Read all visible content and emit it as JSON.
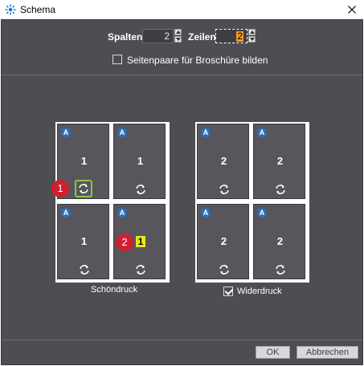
{
  "window": {
    "title": "Schema",
    "icon": "schema-grid-icon",
    "close_icon": "close-icon"
  },
  "grid": {
    "spalten_label": "Spalten",
    "spalten_value": "2",
    "zeilen_label": "Zeilen",
    "zeilen_value": "2"
  },
  "options": {
    "booklet_label": "Seitenpaare für Broschüre bilden",
    "booklet_checked": false
  },
  "front": {
    "caption": "Schöndruck",
    "pages": [
      {
        "badge": "A",
        "number": "1"
      },
      {
        "badge": "A",
        "number": "1"
      },
      {
        "badge": "A",
        "number": "1"
      },
      {
        "badge": "A",
        "number": "1"
      }
    ]
  },
  "back": {
    "caption": "Widerdruck",
    "checked": true,
    "pages": [
      {
        "badge": "A",
        "number": "2"
      },
      {
        "badge": "A",
        "number": "2"
      },
      {
        "badge": "A",
        "number": "2"
      },
      {
        "badge": "A",
        "number": "2"
      }
    ]
  },
  "markers": {
    "first": "1",
    "second": "2"
  },
  "footer": {
    "ok_label": "OK",
    "cancel_label": "Abbrechen"
  },
  "colors": {
    "background": "#4e4d52",
    "badge": "#2b6fb8",
    "marker": "#d01f2f",
    "highlight_green": "#8cc63f",
    "highlight_yellow": "#e8e61a",
    "focus_orange": "#f29b1c"
  }
}
